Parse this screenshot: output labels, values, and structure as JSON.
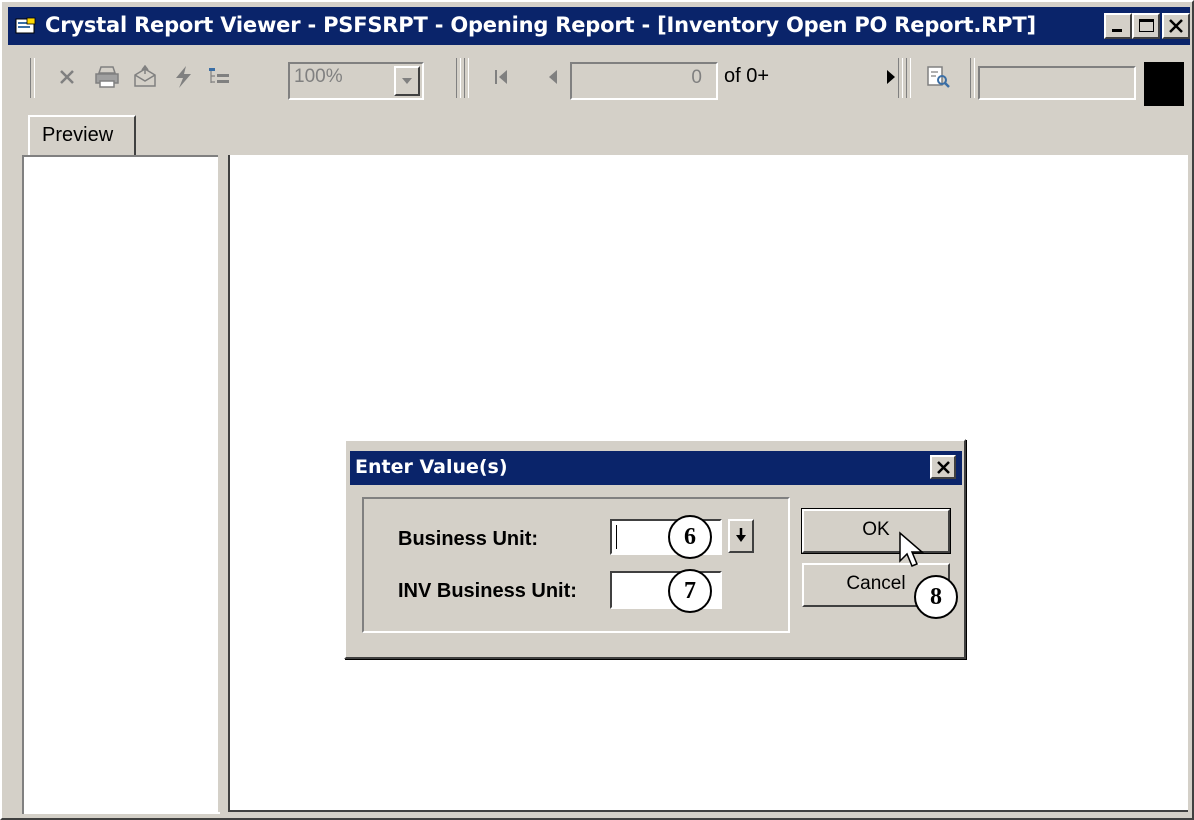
{
  "window": {
    "title": "Crystal Report Viewer - PSFSRPT - Opening Report - [Inventory Open PO Report.RPT]"
  },
  "toolbar": {
    "zoom_value": "100%",
    "page_number": "0",
    "page_of": "of 0+",
    "icons": [
      "close-view-icon",
      "print-icon",
      "export-icon",
      "refresh-icon",
      "group-tree-toggle-icon",
      "first-page-icon",
      "previous-page-icon",
      "next-page-icon",
      "search-icon"
    ]
  },
  "tabs": [
    {
      "label": "Preview"
    }
  ],
  "dialog": {
    "title": "Enter Value(s)",
    "fields": [
      {
        "label": "Business Unit:",
        "value": "",
        "callout": "6"
      },
      {
        "label": "INV Business Unit:",
        "value": "",
        "callout": "7"
      }
    ],
    "ok_label": "OK",
    "cancel_label": "Cancel",
    "cancel_callout": "8"
  },
  "colors": {
    "titlebar": "#0a246a",
    "face": "#d4d0c8"
  }
}
